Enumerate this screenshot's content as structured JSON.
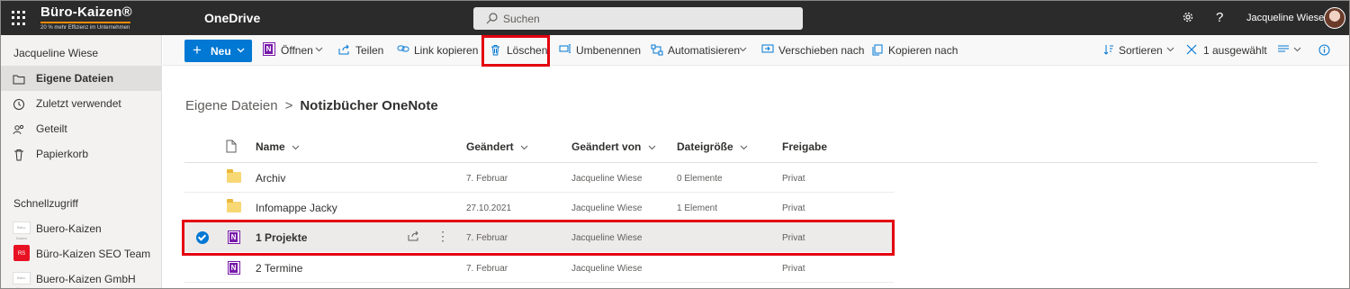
{
  "topbar": {
    "logo_title": "Büro-Kaizen®",
    "logo_subtitle": "20 % mehr Effizienz im Unternehmen",
    "app_name": "OneDrive",
    "search_placeholder": "Suchen",
    "help_glyph": "?",
    "user_name": "Jacqueline Wiese"
  },
  "sidebar": {
    "user": "Jacqueline Wiese",
    "items": [
      {
        "label": "Eigene Dateien",
        "icon": "folder-icon",
        "active": true
      },
      {
        "label": "Zuletzt verwendet",
        "icon": "history-icon"
      },
      {
        "label": "Geteilt",
        "icon": "people-icon"
      },
      {
        "label": "Papierkorb",
        "icon": "recycle-bin-icon"
      }
    ],
    "quick_access_title": "Schnellzugriff",
    "quick_access": [
      {
        "label": "Buero-Kaizen",
        "thumb": "Büro-Kaizen"
      },
      {
        "label": "Büro-Kaizen SEO Team",
        "thumb": "RS"
      },
      {
        "label": "Buero-Kaizen GmbH",
        "thumb": "Büro-Kaizen"
      }
    ]
  },
  "commandbar": {
    "new": "Neu",
    "open": "Öffnen",
    "share": "Teilen",
    "copy_link": "Link kopieren",
    "delete": "Löschen",
    "rename": "Umbenennen",
    "automate": "Automatisieren",
    "move_to": "Verschieben nach",
    "copy_to": "Kopieren nach",
    "sort": "Sortieren",
    "selected": "1 ausgewählt"
  },
  "breadcrumb": {
    "root": "Eigene Dateien",
    "separator": ">",
    "current": "Notizbücher OneNote"
  },
  "table": {
    "headers": {
      "name": "Name",
      "modified": "Geändert",
      "modified_by": "Geändert von",
      "size": "Dateigröße",
      "sharing": "Freigabe"
    },
    "rows": [
      {
        "name": "Archiv",
        "modified": "7. Februar",
        "modified_by": "Jacqueline Wiese",
        "size": "0 Elemente",
        "sharing": "Privat"
      },
      {
        "name": "Infomappe Jacky",
        "modified": "27.10.2021",
        "modified_by": "Jacqueline Wiese",
        "size": "1 Element",
        "sharing": "Privat"
      },
      {
        "name": "1 Projekte",
        "modified": "7. Februar",
        "modified_by": "Jacqueline Wiese",
        "size": "",
        "sharing": "Privat",
        "more_glyph": "⋮"
      },
      {
        "name": "2 Termine",
        "modified": "7. Februar",
        "modified_by": "Jacqueline Wiese",
        "size": "",
        "sharing": "Privat"
      }
    ]
  },
  "colors": {
    "topbar_bg": "#2b2b2b",
    "accent": "#0078d4",
    "highlight": "#e3000f",
    "onenote": "#7719aa",
    "folder": "#f8d775"
  }
}
